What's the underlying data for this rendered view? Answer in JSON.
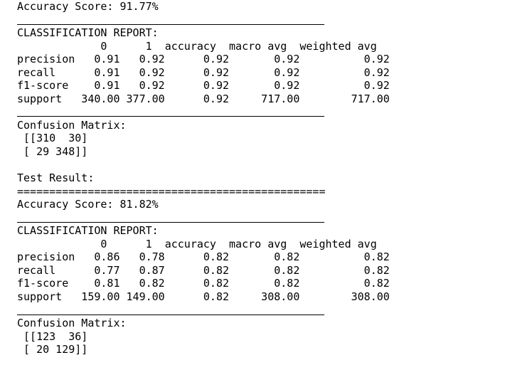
{
  "output_lines": [
    {
      "text": "Accuracy Score: 91.77%",
      "rule": false
    },
    {
      "text": "",
      "rule": true
    },
    {
      "text": "CLASSIFICATION REPORT:",
      "rule": false
    },
    {
      "text": "             0      1  accuracy  macro avg  weighted avg",
      "rule": false
    },
    {
      "text": "precision   0.91   0.92      0.92       0.92          0.92",
      "rule": false
    },
    {
      "text": "recall      0.91   0.92      0.92       0.92          0.92",
      "rule": false
    },
    {
      "text": "f1-score    0.91   0.92      0.92       0.92          0.92",
      "rule": false
    },
    {
      "text": "support   340.00 377.00      0.92     717.00        717.00",
      "rule": false
    },
    {
      "text": "",
      "rule": true
    },
    {
      "text": "Confusion Matrix:",
      "rule": false
    },
    {
      "text": " [[310  30]",
      "rule": false
    },
    {
      "text": " [ 29 348]]",
      "rule": false
    },
    {
      "text": "",
      "rule": false
    },
    {
      "text": "Test Result:",
      "rule": false
    },
    {
      "text": "================================================",
      "rule": false
    },
    {
      "text": "Accuracy Score: 81.82%",
      "rule": false
    },
    {
      "text": "",
      "rule": true
    },
    {
      "text": "CLASSIFICATION REPORT:",
      "rule": false
    },
    {
      "text": "             0      1  accuracy  macro avg  weighted avg",
      "rule": false
    },
    {
      "text": "precision   0.86   0.78      0.82       0.82          0.82",
      "rule": false
    },
    {
      "text": "recall      0.77   0.87      0.82       0.82          0.82",
      "rule": false
    },
    {
      "text": "f1-score    0.81   0.82      0.82       0.82          0.82",
      "rule": false
    },
    {
      "text": "support   159.00 149.00      0.82     308.00        308.00",
      "rule": false
    },
    {
      "text": "",
      "rule": true
    },
    {
      "text": "Confusion Matrix:",
      "rule": false
    },
    {
      "text": " [[123  36]",
      "rule": false
    },
    {
      "text": " [ 20 129]]",
      "rule": false
    }
  ]
}
